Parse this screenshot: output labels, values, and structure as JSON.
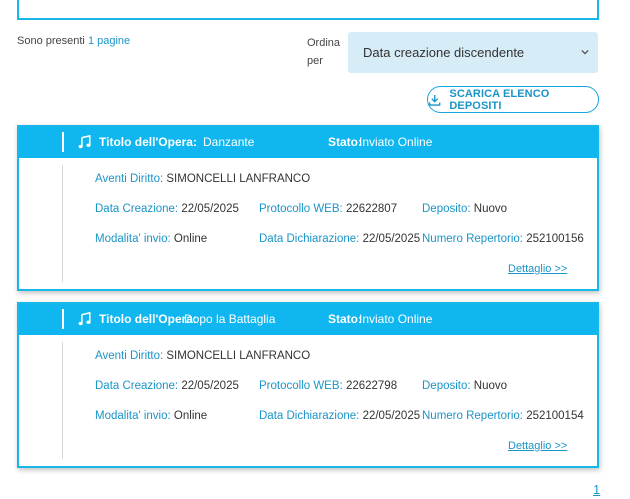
{
  "results": {
    "prefix": "Sono presenti",
    "count_link": "1 pagine"
  },
  "ordering": {
    "label_line1": "Ordina",
    "label_line2": "per",
    "selected": "Data creazione discendente"
  },
  "download_button": {
    "label": "SCARICA ELENCO DEPOSITI"
  },
  "labels": {
    "title": "Titolo dell'Opera:",
    "state": "Stato:",
    "aventi_diritto": "Aventi Diritto:",
    "data_creazione": "Data Creazione:",
    "protocollo_web": "Protocollo WEB:",
    "deposito": "Deposito:",
    "modalita_invio": "Modalita' invio:",
    "data_dichiarazione": "Data Dichiarazione:",
    "numero_repertorio": "Numero Repertorio:",
    "dettaglio": "Dettaglio >>"
  },
  "cards": [
    {
      "title": "Danzante",
      "state": "Inviato Online",
      "aventi_diritto": "SIMONCELLI LANFRANCO",
      "data_creazione": "22/05/2025",
      "protocollo_web": "22622807",
      "deposito": "Nuovo",
      "modalita_invio": "Online",
      "data_dichiarazione": "22/05/2025",
      "numero_repertorio": "252100156"
    },
    {
      "title": "Dopo la Battaglia",
      "state": "Inviato Online",
      "aventi_diritto": "SIMONCELLI LANFRANCO",
      "data_creazione": "22/05/2025",
      "protocollo_web": "22622798",
      "deposito": "Nuovo",
      "modalita_invio": "Online",
      "data_dichiarazione": "22/05/2025",
      "numero_repertorio": "252100154"
    }
  ],
  "pagination": {
    "current_page": "1"
  },
  "icons": {
    "music": "music-note-icon",
    "download": "download-icon",
    "select_arrow": "chevron-down-icon"
  },
  "colors": {
    "accent": "#0fb6ef",
    "link": "#1a95c8",
    "select_bg": "#d6ecf7"
  }
}
